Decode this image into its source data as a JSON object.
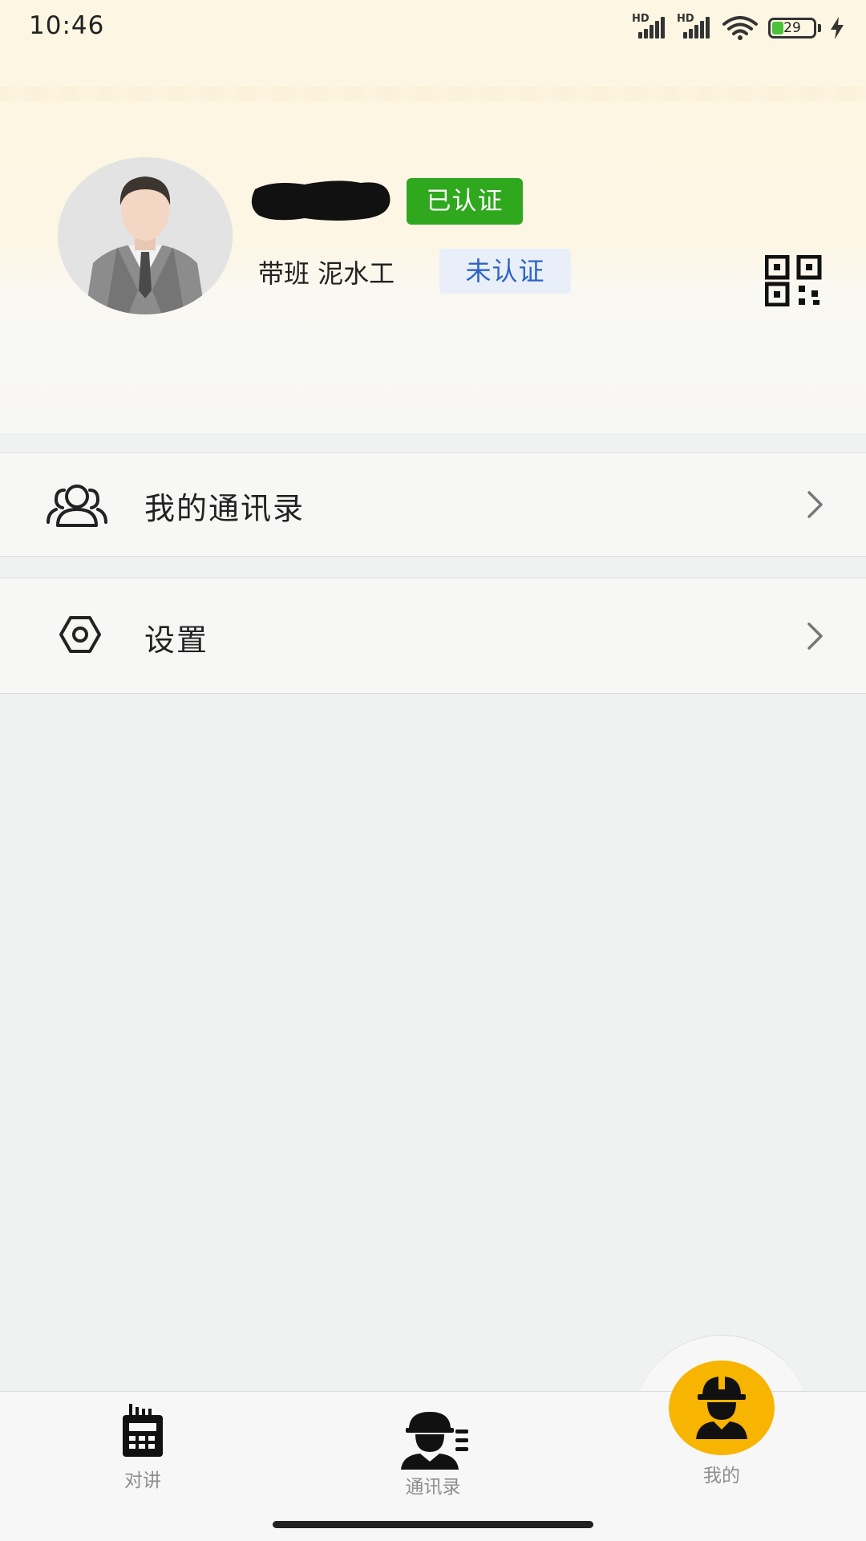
{
  "status_bar": {
    "time": "10:46",
    "network_1": "HD",
    "network_2": "HD",
    "battery_level": "29"
  },
  "profile": {
    "verified_badge": "已认证",
    "role": "带班 泥水工",
    "unverified_badge": "未认证"
  },
  "menu": {
    "items": [
      {
        "label": "我的通讯录",
        "icon": "contacts-group-icon"
      },
      {
        "label": "设置",
        "icon": "settings-hexagon-icon"
      }
    ]
  },
  "bottom_nav": {
    "tabs": [
      {
        "label": "对讲",
        "icon": "walkie-talkie-icon",
        "active": false
      },
      {
        "label": "通讯录",
        "icon": "worker-contacts-icon",
        "active": false
      },
      {
        "label": "我的",
        "icon": "worker-helmet-icon",
        "active": true
      }
    ]
  },
  "colors": {
    "verified_green": "#2fa81e",
    "unverified_blue": "#2e63c4",
    "active_tab_yellow": "#f7b400",
    "header_cream": "#fdf6e2"
  }
}
